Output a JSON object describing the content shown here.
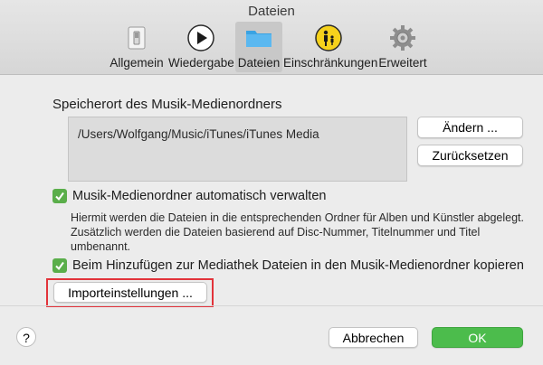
{
  "window": {
    "title": "Dateien"
  },
  "toolbar": {
    "tabs": [
      {
        "label": "Allgemein",
        "icon": "switch-icon"
      },
      {
        "label": "Wiedergabe",
        "icon": "play-icon"
      },
      {
        "label": "Dateien",
        "icon": "folder-icon",
        "active": true
      },
      {
        "label": "Einschränkungen",
        "icon": "parental-icon"
      },
      {
        "label": "Erweitert",
        "icon": "gear-icon"
      }
    ]
  },
  "media_folder": {
    "section_title": "Speicherort des Musik-Medienordners",
    "path": "/Users/Wolfgang/Music/iTunes/iTunes Media",
    "change_label": "Ändern ...",
    "reset_label": "Zurücksetzen"
  },
  "options": {
    "keep_organized_label": "Musik-Medienordner automatisch verwalten",
    "keep_organized_checked": true,
    "keep_organized_desc": "Hiermit werden die Dateien in die entsprechenden Ordner für Alben und Künstler abgelegt. Zusätzlich werden die Dateien basierend auf Disc-Nummer, Titelnummer und Titel umbenannt.",
    "copy_files_label": "Beim Hinzufügen zur Mediathek Dateien in den Musik-Medienordner kopieren",
    "copy_files_checked": true,
    "import_settings_label": "Importeinstellungen ..."
  },
  "footer": {
    "help_label": "?",
    "cancel_label": "Abbrechen",
    "ok_label": "OK"
  },
  "colors": {
    "checkbox": "#5aae4a",
    "ok_button": "#4cbc4c",
    "highlight": "#e2333a"
  }
}
